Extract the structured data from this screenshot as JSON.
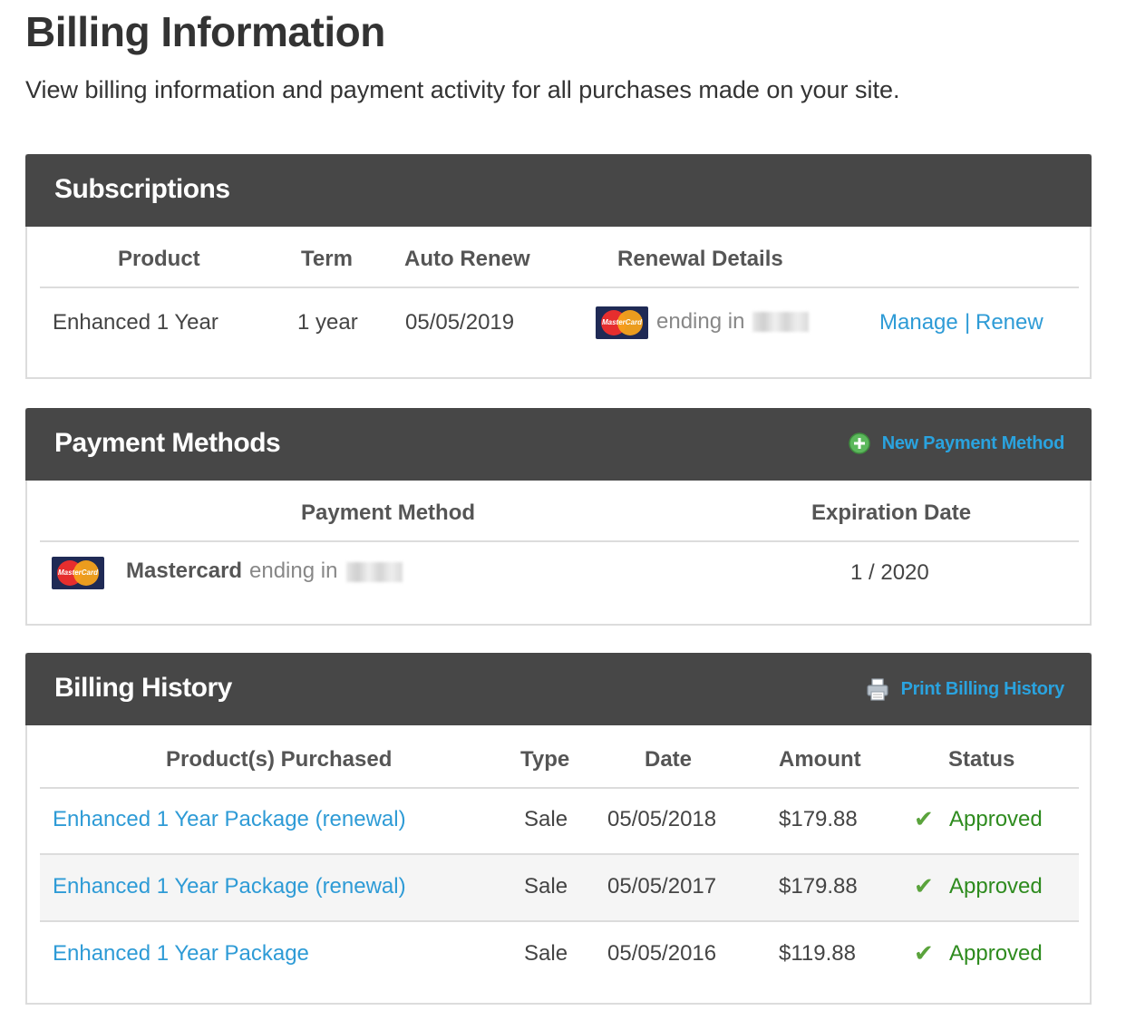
{
  "page": {
    "title": "Billing Information",
    "subtitle": "View billing information and payment activity for all purchases made on your site."
  },
  "subscriptions": {
    "title": "Subscriptions",
    "headers": {
      "product": "Product",
      "term": "Term",
      "auto_renew": "Auto Renew",
      "renewal_details": "Renewal Details"
    },
    "row": {
      "product": "Enhanced 1 Year",
      "term": "1 year",
      "auto_renew": "05/05/2019",
      "renewal_text": "ending in",
      "card_logo_text": "MasterCard",
      "manage": "Manage",
      "divider": "|",
      "renew": "Renew"
    }
  },
  "payment_methods": {
    "title": "Payment Methods",
    "action_label": "New Payment Method",
    "action_icon": "plus-circle-icon",
    "headers": {
      "method": "Payment Method",
      "expiration": "Expiration Date"
    },
    "row": {
      "card_name": "Mastercard",
      "ending_text": "ending in",
      "card_logo_text": "MasterCard",
      "expiration": "1 / 2020"
    }
  },
  "billing_history": {
    "title": "Billing History",
    "action_label": "Print Billing History",
    "action_icon": "printer-icon",
    "headers": {
      "product": "Product(s) Purchased",
      "type": "Type",
      "date": "Date",
      "amount": "Amount",
      "status": "Status"
    },
    "rows": [
      {
        "product": "Enhanced 1 Year Package (renewal)",
        "type": "Sale",
        "date": "05/05/2018",
        "amount": "$179.88",
        "status": "Approved"
      },
      {
        "product": "Enhanced 1 Year Package (renewal)",
        "type": "Sale",
        "date": "05/05/2017",
        "amount": "$179.88",
        "status": "Approved"
      },
      {
        "product": "Enhanced 1 Year Package",
        "type": "Sale",
        "date": "05/05/2016",
        "amount": "$119.88",
        "status": "Approved"
      }
    ]
  },
  "colors": {
    "header_bg": "#474747",
    "link": "#2e9bd6",
    "approved": "#2e8b1e"
  }
}
